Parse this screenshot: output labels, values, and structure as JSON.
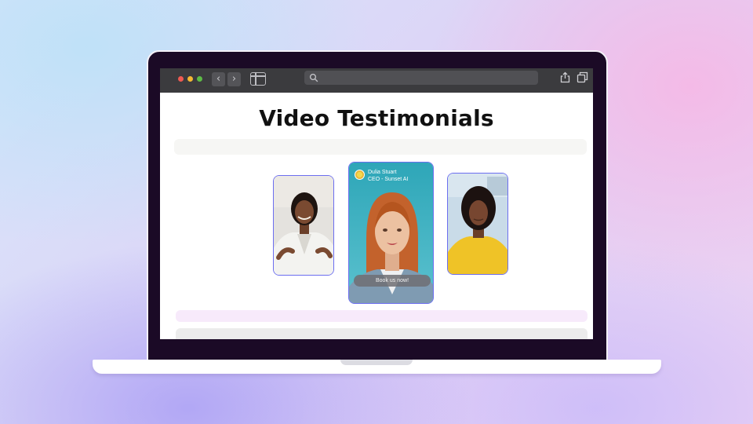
{
  "page": {
    "title": "Video Testimonials"
  },
  "browser": {
    "traffic_lights": {
      "close": "#ee5a52",
      "minimize": "#f4b833",
      "maximize": "#5dbb46"
    },
    "back_icon": "‹",
    "forward_icon": "›",
    "address_bar": {
      "placeholder": ""
    }
  },
  "testimonials": {
    "featured": {
      "name": "Dulia Stuart",
      "role": "CEO - Sunset AI",
      "cta_label": "Book us now!"
    }
  },
  "colors": {
    "card_border": "#6c6ef0",
    "skeleton_top": "#f6f6f4",
    "skeleton_pink": "#f7eafb",
    "skeleton_gray": "#ececec"
  }
}
